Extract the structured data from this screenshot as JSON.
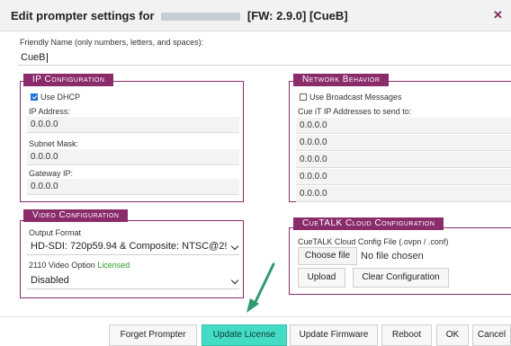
{
  "dialog": {
    "title_prefix": "Edit prompter settings for",
    "title_suffix": "[FW: 2.9.0] [CueB]",
    "close_icon": "close-icon"
  },
  "friendly_name": {
    "label": "Friendly Name (only numbers, letters, and spaces):",
    "value": "CueB"
  },
  "ip_config": {
    "title": "IP Configuration",
    "use_dhcp_label": "Use DHCP",
    "use_dhcp_checked": true,
    "ip_label": "IP Address:",
    "ip_value": "0.0.0.0",
    "subnet_label": "Subnet Mask:",
    "subnet_value": "0.0.0.0",
    "gateway_label": "Gateway IP:",
    "gateway_value": "0.0.0.0"
  },
  "network": {
    "title": "Network Behavior",
    "broadcast_label": "Use Broadcast Messages",
    "broadcast_checked": false,
    "send_to_label": "Cue iT IP Addresses to send to:",
    "addresses": [
      "0.0.0.0",
      "0.0.0.0",
      "0.0.0.0",
      "0.0.0.0",
      "0.0.0.0"
    ]
  },
  "video": {
    "title": "Video Configuration",
    "output_label": "Output Format",
    "output_value": "HD-SDI: 720p59.94 & Composite: NTSC@2!",
    "option_label": "2110 Video Option",
    "option_status": "Licensed",
    "option_value": "Disabled"
  },
  "cuetalk": {
    "title": "CueTALK Cloud Configuration",
    "file_label": "CueTALK Cloud Config File (.ovpn / .conf)",
    "choose_label": "Choose file",
    "no_file_label": "No file chosen",
    "upload_label": "Upload",
    "clear_label": "Clear Configuration"
  },
  "footer": {
    "forget_label": "Forget Prompter",
    "update_license_label": "Update License",
    "update_firmware_label": "Update Firmware",
    "reboot_label": "Reboot",
    "ok_label": "OK",
    "cancel_label": "Cancel"
  },
  "colors": {
    "accent": "#8a2b6b",
    "primary_button": "#44dcc4",
    "arrow": "#2e9a6e"
  }
}
